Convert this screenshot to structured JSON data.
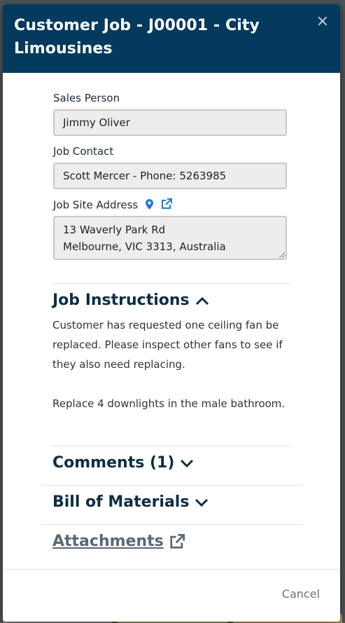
{
  "modal": {
    "title": "Customer Job - J00001 - City Limousines",
    "close_label": "×"
  },
  "fields": {
    "sales_person": {
      "label": "Sales Person",
      "value": "Jimmy Oliver"
    },
    "job_contact": {
      "label": "Job Contact",
      "value": "Scott Mercer - Phone: 5263985"
    },
    "job_site_address": {
      "label": "Job Site Address",
      "line1": "13 Waverly Park Rd",
      "line2": "Melbourne, VIC 3313, Australia"
    }
  },
  "sections": {
    "job_instructions": {
      "title": "Job Instructions",
      "paragraph1": "Customer has requested one ceiling fan be replaced. Please inspect other fans to see if they also need replacing.",
      "paragraph2": "Replace 4 downlights in the male bathroom."
    },
    "comments": {
      "title": "Comments (1)"
    },
    "bill_of_materials": {
      "title": "Bill of Materials"
    },
    "attachments": {
      "title": "Attachments"
    }
  },
  "footer": {
    "cancel_label": "Cancel"
  },
  "icons": {
    "map_pin": "map-pin-icon",
    "external_link": "external-link-icon",
    "chevron_up": "chevron-up-icon",
    "chevron_down": "chevron-down-icon"
  },
  "colors": {
    "header_bg": "#053a5f",
    "accent": "#1e7bd0",
    "heading": "#0e2d45"
  }
}
